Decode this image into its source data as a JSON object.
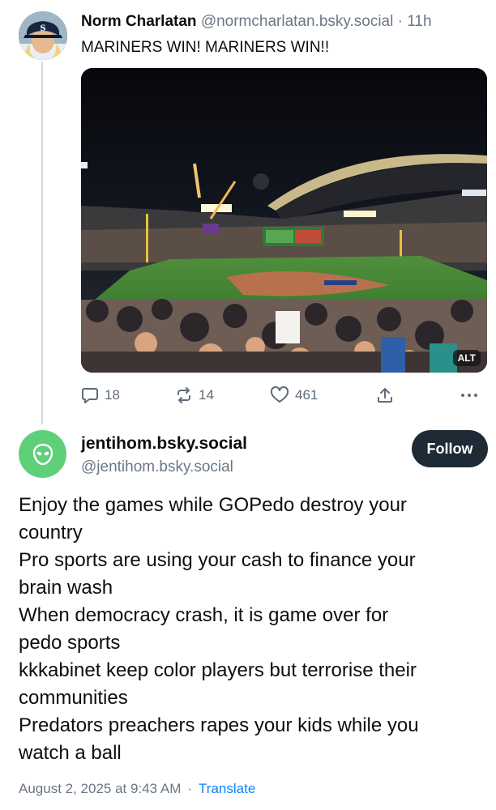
{
  "parent_post": {
    "author_name": "Norm Charlatan",
    "author_handle": "@normcharlatan.bsky.social",
    "separator": "·",
    "age": "11h",
    "text": "MARINERS WIN! MARINERS WIN!!",
    "image_alt_badge": "ALT",
    "actions": {
      "reply_icon": "speech-bubble-icon",
      "reply_count": "18",
      "repost_icon": "repost-arrows-icon",
      "repost_count": "14",
      "like_icon": "heart-icon",
      "like_count": "461",
      "share_icon": "share-icon",
      "more_icon": "ellipsis-icon"
    }
  },
  "reply_post": {
    "avatar_icon": "alien-icon",
    "author_name": "jentihom.bsky.social",
    "author_handle": "@jentihom.bsky.social",
    "follow_label": "Follow",
    "lines": [
      "Enjoy the games while GOPedo destroy your",
      "country",
      "Pro sports are using your cash to finance your",
      "brain wash",
      "When democracy crash, it is game over for",
      "pedo sports",
      "kkkabinet  keep color players but terrorise their",
      "communities",
      "Predators preachers rapes your kids while you",
      "watch a ball"
    ],
    "timestamp": "August 2, 2025 at 9:43 AM",
    "meta_separator": "·",
    "translate_label": "Translate"
  },
  "colors": {
    "accent_link": "#1083fe",
    "follow_button_bg": "#1e2a36",
    "reply_avatar_bg": "#5fd07a",
    "secondary_text": "#6b7785"
  }
}
